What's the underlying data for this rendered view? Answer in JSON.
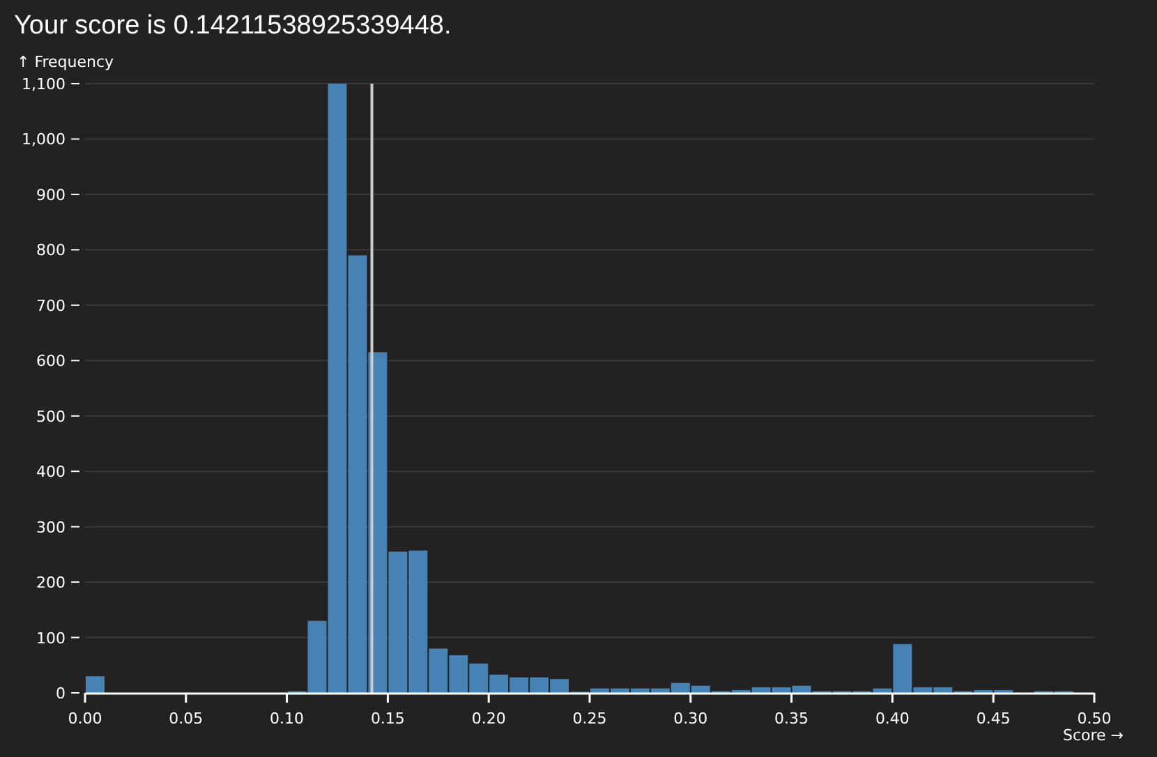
{
  "title": "Your score is 0.14211538925339448.",
  "chart": {
    "chart_data": {
      "type": "bar",
      "xlabel": "Score →",
      "ylabel": "↑ Frequency",
      "grid": true,
      "x": [
        0.005,
        0.015,
        0.025,
        0.035,
        0.045,
        0.055,
        0.065,
        0.075,
        0.085,
        0.095,
        0.105,
        0.115,
        0.125,
        0.135,
        0.145,
        0.155,
        0.165,
        0.175,
        0.185,
        0.195,
        0.205,
        0.215,
        0.225,
        0.235,
        0.245,
        0.255,
        0.265,
        0.275,
        0.285,
        0.295,
        0.305,
        0.315,
        0.325,
        0.335,
        0.345,
        0.355,
        0.365,
        0.375,
        0.385,
        0.395,
        0.405,
        0.415,
        0.425,
        0.435,
        0.445,
        0.455,
        0.465,
        0.475,
        0.485,
        0.495
      ],
      "series": [
        {
          "color": "#4682b4",
          "values": [
            30,
            null,
            0,
            0,
            0,
            0,
            0,
            0,
            0,
            0,
            3,
            130,
            1100,
            790,
            615,
            255,
            257,
            80,
            68,
            53,
            33,
            28,
            28,
            25,
            2,
            8,
            8,
            8,
            8,
            18,
            13,
            3,
            5,
            10,
            10,
            13,
            3,
            3,
            3,
            8,
            88,
            10,
            10,
            3,
            5,
            5,
            0,
            3,
            3,
            0
          ]
        }
      ],
      "xlim": [
        0,
        0.5
      ],
      "ylim": [
        0,
        1100
      ],
      "xticks": [
        {
          "value": 0,
          "label": "0.00"
        },
        {
          "value": 0.05,
          "label": "0.05"
        },
        {
          "value": 0.1,
          "label": "0.10"
        },
        {
          "value": 0.15,
          "label": "0.15"
        },
        {
          "value": 0.2,
          "label": "0.20"
        },
        {
          "value": 0.25,
          "label": "0.25"
        },
        {
          "value": 0.3,
          "label": "0.30"
        },
        {
          "value": 0.35,
          "label": "0.35"
        },
        {
          "value": 0.4,
          "label": "0.40"
        },
        {
          "value": 0.45,
          "label": "0.45"
        },
        {
          "value": 0.5,
          "label": "0.50"
        }
      ],
      "yticks": [
        0,
        {
          "value": 100,
          "label": "100"
        },
        {
          "value": 200,
          "label": "200"
        },
        {
          "value": 300,
          "label": "300"
        },
        {
          "value": 400,
          "label": "400"
        },
        {
          "value": 500,
          "label": "500"
        },
        {
          "value": 600,
          "label": "600"
        },
        {
          "value": 700,
          "label": "700"
        },
        {
          "value": 800,
          "label": "800"
        },
        {
          "value": 900,
          "label": "900"
        },
        {
          "value": 1000,
          "label": "1,000"
        },
        {
          "value": 1100,
          "label": "1,100"
        }
      ],
      "ref_lines": [
        {
          "axis": "x",
          "value": 0.14211538925339448,
          "color": "#cccccc"
        }
      ]
    }
  }
}
